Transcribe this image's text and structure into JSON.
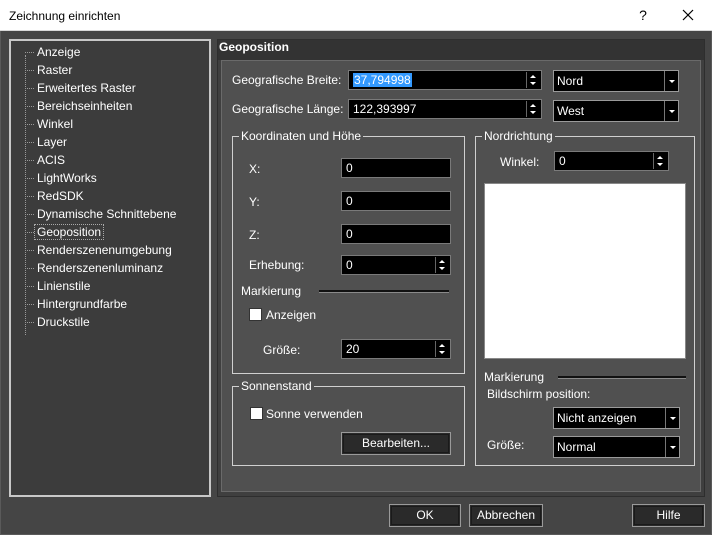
{
  "window": {
    "title": "Zeichnung einrichten",
    "help_glyph": "?"
  },
  "tree": {
    "items": [
      "Anzeige",
      "Raster",
      "Erweitertes Raster",
      "Bereichseinheiten",
      "Winkel",
      "Layer",
      "ACIS",
      "LightWorks",
      "RedSDK",
      "Dynamische Schnittebene",
      "Geoposition",
      "Renderszenenumgebung",
      "Renderszenenluminanz",
      "Linienstile",
      "Hintergrundfarbe",
      "Druckstile"
    ],
    "selected": "Geoposition"
  },
  "panel": {
    "title": "Geoposition"
  },
  "geo": {
    "latitude_label": "Geografische Breite:",
    "latitude_value": "37,794998",
    "latitude_dir": "Nord",
    "longitude_label": "Geografische Länge:",
    "longitude_value": "122,393997",
    "longitude_dir": "West"
  },
  "coords": {
    "group_title": "Koordinaten und Höhe",
    "x_label": "X:",
    "x_value": "0",
    "y_label": "Y:",
    "y_value": "0",
    "z_label": "Z:",
    "z_value": "0",
    "elevation_label": "Erhebung:",
    "elevation_value": "0",
    "marker_label": "Markierung",
    "show_label": "Anzeigen",
    "size_label": "Größe:",
    "size_value": "20"
  },
  "north": {
    "group_title": "Nordrichtung",
    "angle_label": "Winkel:",
    "angle_value": "0",
    "marker_label": "Markierung",
    "screen_pos_label": "Bildschirm position:",
    "screen_pos_value": "Nicht anzeigen",
    "size_label": "Größe:",
    "size_value": "Normal"
  },
  "sun": {
    "group_title": "Sonnenstand",
    "use_sun_label": "Sonne verwenden",
    "edit_label": "Bearbeiten..."
  },
  "footer": {
    "ok_label": "OK",
    "cancel_label": "Abbrechen",
    "help_label": "Hilfe"
  }
}
